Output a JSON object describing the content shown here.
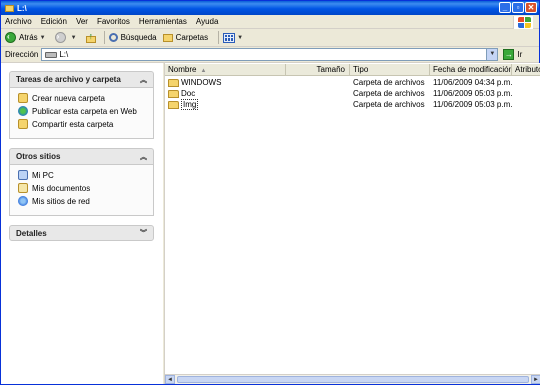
{
  "window": {
    "title": "L:\\"
  },
  "menu": [
    {
      "label": "Archivo"
    },
    {
      "label": "Edición"
    },
    {
      "label": "Ver"
    },
    {
      "label": "Favoritos"
    },
    {
      "label": "Herramientas"
    },
    {
      "label": "Ayuda"
    }
  ],
  "toolbar": {
    "back_label": "Atrás",
    "search_label": "Búsqueda",
    "folders_label": "Carpetas"
  },
  "address": {
    "label": "Dirección",
    "value": "L:\\",
    "go_label": "Ir"
  },
  "taskpane": {
    "file_tasks": {
      "title": "Tareas de archivo y carpeta",
      "items": [
        {
          "label": "Crear nueva carpeta",
          "icon": "new-folder-icon"
        },
        {
          "label": "Publicar esta carpeta en Web",
          "icon": "web-publish-icon"
        },
        {
          "label": "Compartir esta carpeta",
          "icon": "share-folder-icon"
        }
      ]
    },
    "other_places": {
      "title": "Otros sitios",
      "items": [
        {
          "label": "Mi PC",
          "icon": "my-computer-icon"
        },
        {
          "label": "Mis documentos",
          "icon": "my-documents-icon"
        },
        {
          "label": "Mis sitios de red",
          "icon": "network-places-icon"
        }
      ]
    },
    "details": {
      "title": "Detalles"
    }
  },
  "list": {
    "columns": {
      "name": "Nombre",
      "size": "Tamaño",
      "type": "Tipo",
      "date": "Fecha de modificación",
      "attr": "Atributos"
    },
    "rows": [
      {
        "name": "WINDOWS",
        "size": "",
        "type": "Carpeta de archivos",
        "date": "11/06/2009 04:34 p.m."
      },
      {
        "name": "Doc",
        "size": "",
        "type": "Carpeta de archivos",
        "date": "11/06/2009 05:03 p.m."
      },
      {
        "name": "Img",
        "size": "",
        "type": "Carpeta de archivos",
        "date": "11/06/2009 05:03 p.m."
      }
    ]
  }
}
